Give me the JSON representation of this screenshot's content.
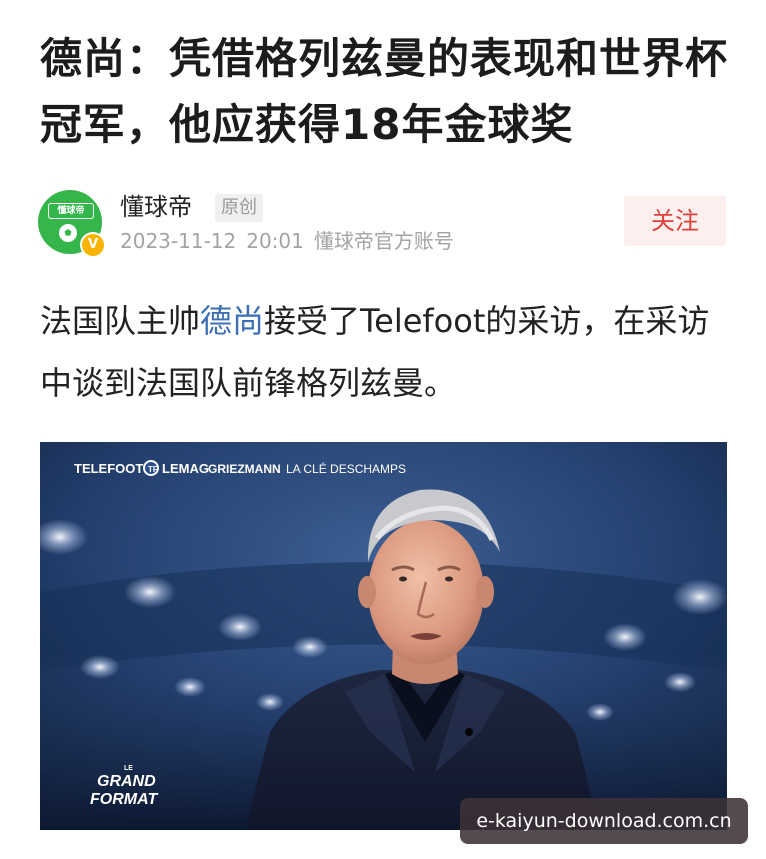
{
  "article": {
    "title": "德尚：凭借格列兹曼的表现和世界杯冠军，他应获得18年金球奖"
  },
  "author": {
    "name": "懂球帝",
    "badge": "原创",
    "date": "2023-11-12",
    "time": "20:01",
    "account_type": "懂球帝官方账号",
    "avatar_text": "懂球帝",
    "verified_icon": "V",
    "follow_label": "关注"
  },
  "lead": {
    "part1": "法国队主帅",
    "link": "德尚",
    "part2": "接受了Telefoot的采访，在采访中谈到法国队前锋格列兹曼。"
  },
  "video": {
    "brand_left": "TELEFOOT",
    "brand_right": "LEMAG",
    "subject": "GRIEZMANN",
    "caption": "LA CLÉ DESCHAMPS",
    "logo_small": "LE",
    "logo_line1": "GRAND",
    "logo_line2": "FORMAT"
  },
  "watermark": {
    "text": "e-kaiyun-download.com.cn"
  },
  "colors": {
    "follow_text": "#e0403a",
    "follow_bg": "#fcefee",
    "link": "#3a6fb6",
    "avatar_green": "#35b64a",
    "verified_gold": "#f7b500"
  }
}
